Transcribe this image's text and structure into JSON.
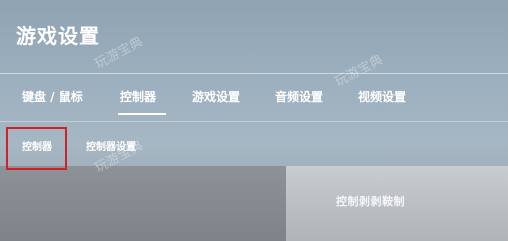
{
  "header": {
    "title": "游戏设置"
  },
  "tabs": [
    {
      "label": "键盘 / 鼠标"
    },
    {
      "label": "控制器"
    },
    {
      "label": "游戏设置"
    },
    {
      "label": "音频设置"
    },
    {
      "label": "视频设置"
    }
  ],
  "active_tab": "控制器",
  "subtabs": [
    {
      "label": "控制器"
    },
    {
      "label": "控制器设置"
    }
  ],
  "active_subtab": "控制器",
  "content": {
    "right_label": "控制剥剥鞍制"
  },
  "watermark": "玩游宝典",
  "colors": {
    "highlight_border": "#d0202a",
    "text": "#ffffff"
  }
}
